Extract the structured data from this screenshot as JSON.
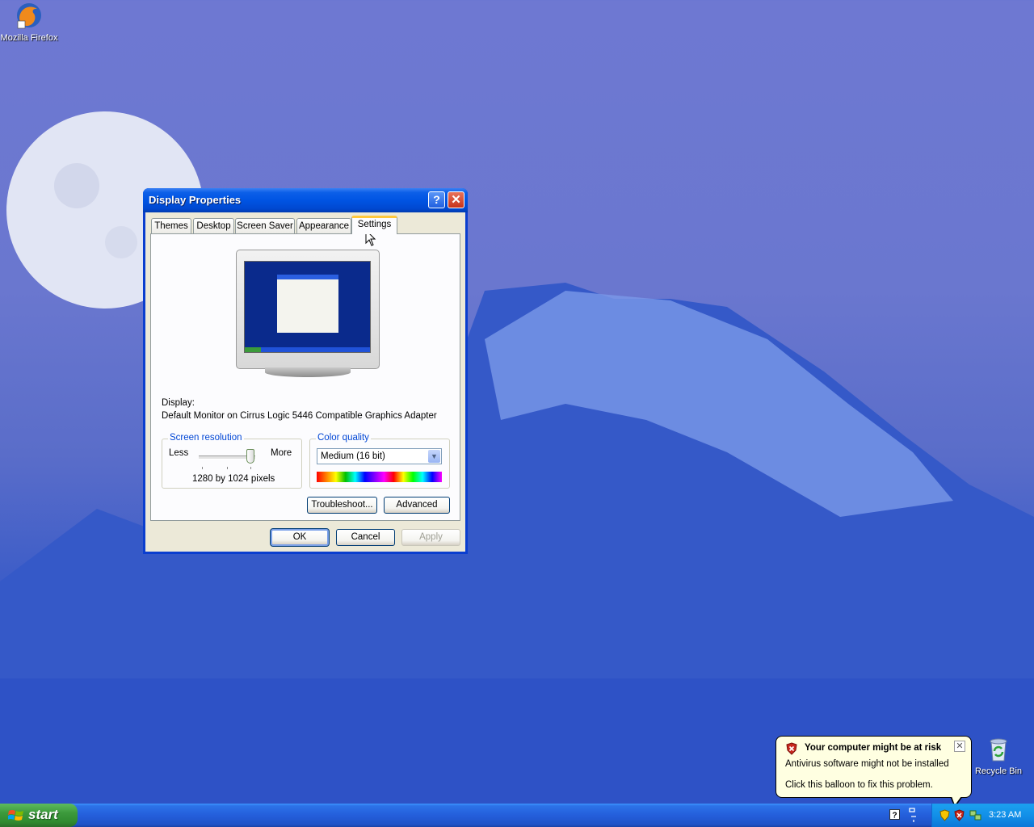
{
  "desktop": {
    "icons": [
      {
        "label": "Mozilla Firefox",
        "icon": "firefox-icon"
      },
      {
        "label": "Recycle Bin",
        "icon": "recycle-bin-icon"
      }
    ]
  },
  "window": {
    "title": "Display Properties",
    "help_glyph": "?",
    "close_glyph": "✕",
    "tabs": [
      {
        "label": "Themes"
      },
      {
        "label": "Desktop"
      },
      {
        "label": "Screen Saver"
      },
      {
        "label": "Appearance"
      },
      {
        "label": "Settings",
        "active": true
      }
    ],
    "display_label": "Display:",
    "display_value": "Default Monitor on Cirrus Logic 5446 Compatible Graphics Adapter",
    "resolution": {
      "group_title": "Screen resolution",
      "less": "Less",
      "more": "More",
      "value_text": "1280 by 1024 pixels",
      "slider_level": 1.0
    },
    "color_quality": {
      "group_title": "Color quality",
      "selected": "Medium (16 bit)",
      "arrow_glyph": "▼"
    },
    "buttons": {
      "troubleshoot": "Troubleshoot...",
      "advanced": "Advanced",
      "ok": "OK",
      "cancel": "Cancel",
      "apply": "Apply"
    }
  },
  "taskbar": {
    "start_label": "start",
    "clock": "3:23 AM"
  },
  "balloon": {
    "title": "Your computer might be at risk",
    "line1": "Antivirus software might not be installed",
    "line2": "Click this balloon to fix this problem.",
    "close_glyph": "✕"
  },
  "colors": {
    "accent": "#0054e3",
    "start_green": "#3c9a3c",
    "group_title": "#0046d5",
    "balloon_bg": "#ffffe1"
  }
}
